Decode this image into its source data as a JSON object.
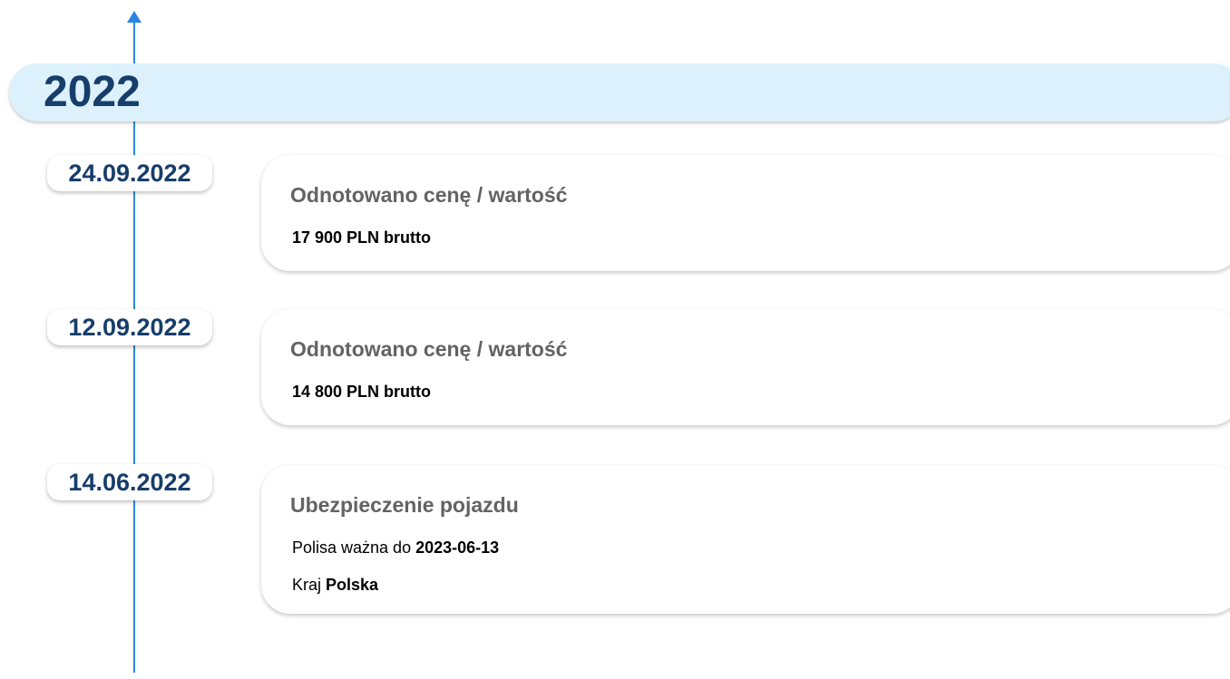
{
  "year": "2022",
  "events": [
    {
      "date": "24.09.2022",
      "title": "Odnotowano cenę / wartość",
      "value": "17 900 PLN brutto"
    },
    {
      "date": "12.09.2022",
      "title": "Odnotowano cenę / wartość",
      "value": "14 800 PLN brutto"
    },
    {
      "date": "14.06.2022",
      "title": "Ubezpieczenie pojazdu",
      "policy_label": "Polisa ważna do",
      "policy_value": "2023-06-13",
      "country_label": "Kraj",
      "country_value": "Polska"
    }
  ],
  "colors": {
    "axis": "#2a86e0",
    "year_bar_bg": "#dcf1fc",
    "date_text": "#173d6a",
    "title_text": "#636363"
  }
}
